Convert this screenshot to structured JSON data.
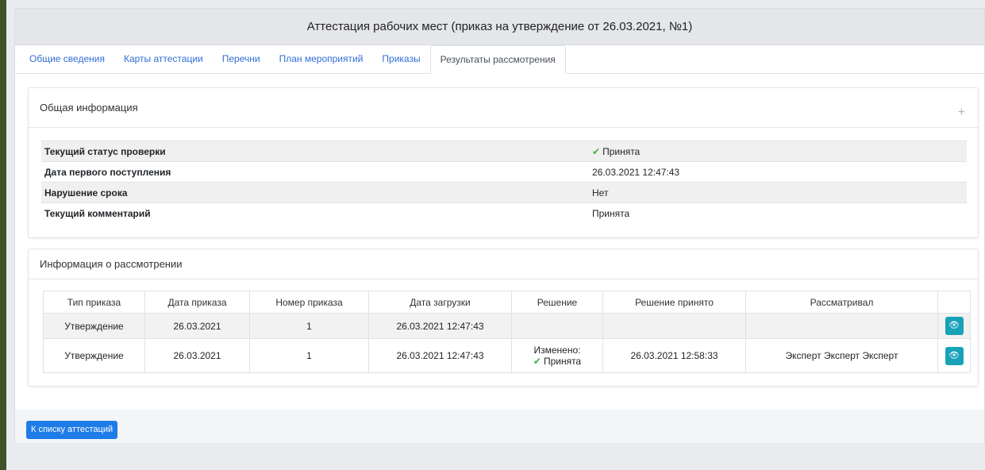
{
  "window": {
    "title": "Аттестация рабочих мест (приказ на утверждение от 26.03.2021, №1)"
  },
  "tabs": [
    {
      "label": "Общие сведения"
    },
    {
      "label": "Карты аттестации"
    },
    {
      "label": "Перечни"
    },
    {
      "label": "План мероприятий"
    },
    {
      "label": "Приказы"
    },
    {
      "label": "Результаты рассмотрения"
    }
  ],
  "active_tab": "Результаты рассмотрения",
  "general": {
    "title": "Общая информация",
    "expand_icon": "plus-icon",
    "rows": [
      {
        "label": "Текущий статус проверки",
        "value": "Принята",
        "icon": "check-icon"
      },
      {
        "label": "Дата первого поступления",
        "value": "26.03.2021 12:47:43"
      },
      {
        "label": "Нарушение срока",
        "value": "Нет"
      },
      {
        "label": "Текущий комментарий",
        "value": "Принята"
      }
    ]
  },
  "review": {
    "title": "Информация о рассмотрении",
    "columns": [
      "Тип приказа",
      "Дата приказа",
      "Номер приказа",
      "Дата загрузки",
      "Решение",
      "Решение принято",
      "Рассматривал"
    ],
    "rows": [
      {
        "type": "Утверждение",
        "order_date": "26.03.2021",
        "number": "1",
        "upload_date": "26.03.2021 12:47:43",
        "decision_prefix": "",
        "decision": "",
        "decided_at": "",
        "reviewer": ""
      },
      {
        "type": "Утверждение",
        "order_date": "26.03.2021",
        "number": "1",
        "upload_date": "26.03.2021 12:47:43",
        "decision_prefix": "Изменено:",
        "decision": "Принята",
        "decided_at": "26.03.2021 12:58:33",
        "reviewer": "Эксперт Эксперт Эксперт"
      }
    ]
  },
  "footer": {
    "back_label": "К списку аттестаций"
  },
  "colors": {
    "accent": "#1e7ce8",
    "info": "#17a2b8",
    "success": "#3fae3f",
    "link": "#2f6fd6"
  }
}
